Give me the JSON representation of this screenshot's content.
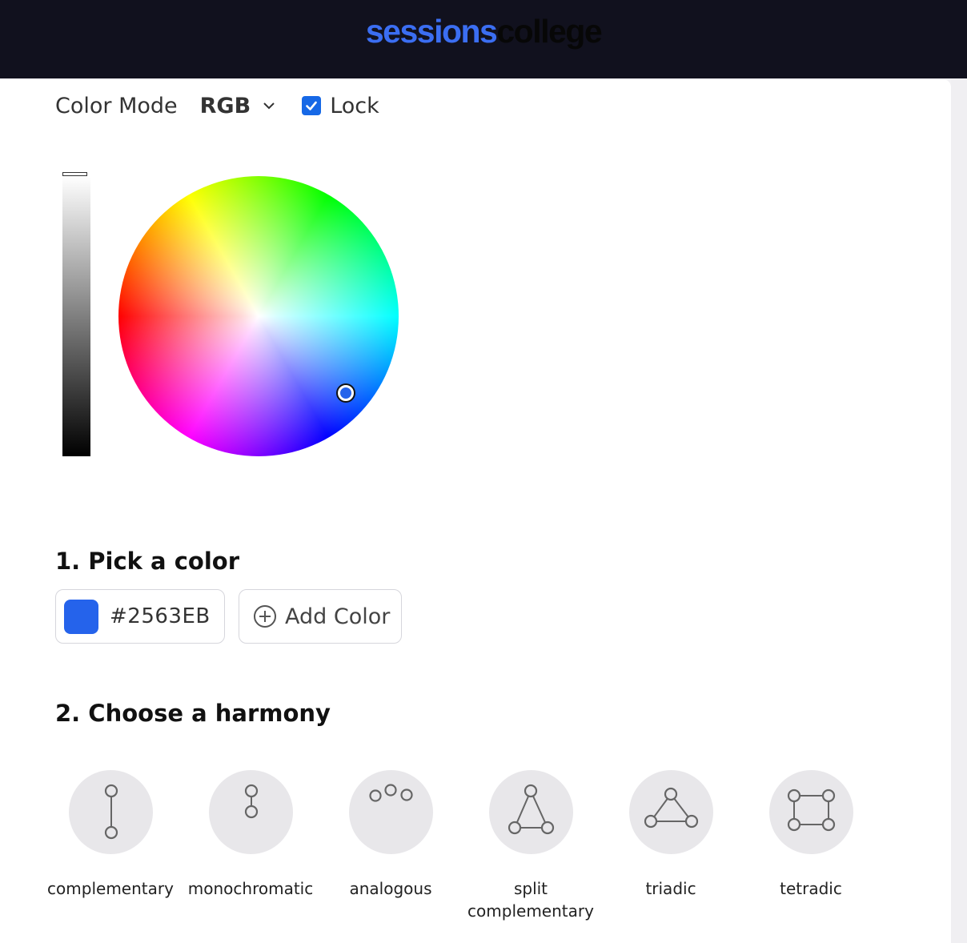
{
  "header": {
    "logo_word1": "sessions",
    "logo_word2": "college"
  },
  "controls": {
    "color_mode_label": "Color Mode",
    "color_mode_value": "RGB",
    "lock_label": "Lock",
    "lock_checked": true
  },
  "picker": {
    "lightness": 1.0,
    "selected_color": "#2563EB"
  },
  "step1": {
    "title": "1. Pick a color",
    "color_hex": "#2563EB",
    "add_color_label": "Add Color"
  },
  "step2": {
    "title": "2. Choose a harmony",
    "harmonies": [
      {
        "label": "complementary",
        "icon": "complementary-icon"
      },
      {
        "label": "monochromatic",
        "icon": "monochromatic-icon"
      },
      {
        "label": "analogous",
        "icon": "analogous-icon"
      },
      {
        "label": "split complementary",
        "icon": "split-complementary-icon"
      },
      {
        "label": "triadic",
        "icon": "triadic-icon"
      },
      {
        "label": "tetradic",
        "icon": "tetradic-icon"
      }
    ]
  },
  "colors": {
    "accent": "#2563EB",
    "header_bg": "#11111E",
    "logo_blue": "#3B6EF2",
    "checkbox": "#1668E6"
  }
}
